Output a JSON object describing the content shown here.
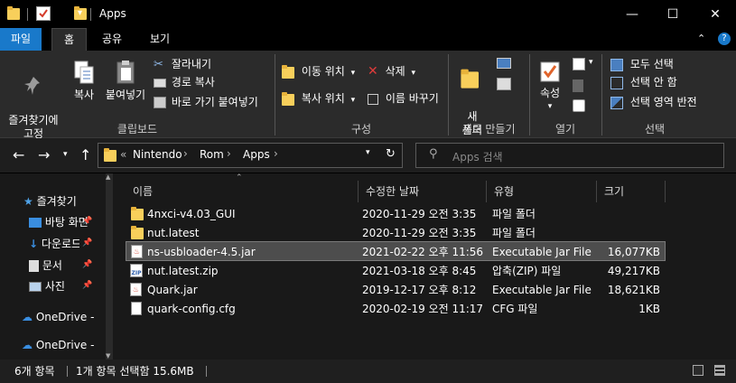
{
  "window": {
    "title": "Apps",
    "minimize": "—",
    "maximize": "☐",
    "close": "✕"
  },
  "tabs": [
    {
      "label": "파일"
    },
    {
      "label": "홈"
    },
    {
      "label": "공유"
    },
    {
      "label": "보기"
    }
  ],
  "ribbon": {
    "clipboard": {
      "pin": "즐겨찾기에\n고정",
      "copy": "복사",
      "paste": "붙여넣기",
      "cut": "잘라내기",
      "copy_path": "경로 복사",
      "paste_shortcut": "바로 가기 붙여넣기",
      "label": "클립보드"
    },
    "organize": {
      "move_to": "이동 위치",
      "copy_to": "복사 위치",
      "delete": "삭제",
      "rename": "이름 바꾸기",
      "label": "구성"
    },
    "new": {
      "new_folder": "새\n폴더",
      "label": "새로 만들기"
    },
    "open": {
      "properties": "속성",
      "label": "열기"
    },
    "select": {
      "select_all": "모두 선택",
      "select_none": "선택 안 함",
      "invert": "선택 영역 반전",
      "label": "선택"
    }
  },
  "address": {
    "prefix": "«",
    "crumbs": [
      "Nintendo",
      "Rom",
      "Apps"
    ],
    "search_placeholder": "Apps 검색"
  },
  "nav": {
    "items": [
      {
        "label": "즐겨찾기"
      },
      {
        "label": "바탕 화면"
      },
      {
        "label": "다운로드"
      },
      {
        "label": "문서"
      },
      {
        "label": "사진"
      },
      {
        "label": "OneDrive -"
      },
      {
        "label": "OneDrive -"
      }
    ]
  },
  "columns": {
    "name": "이름",
    "modified": "수정한 날짜",
    "type": "유형",
    "size": "크기"
  },
  "files": [
    {
      "name": "4nxci-v4.03_GUI",
      "date": "2020-11-29 오전 3:35",
      "type": "파일 폴더",
      "size": "",
      "icon": "folder-icon"
    },
    {
      "name": "nut.latest",
      "date": "2020-11-29 오전 3:35",
      "type": "파일 폴더",
      "size": "",
      "icon": "folder-icon"
    },
    {
      "name": "ns-usbloader-4.5.jar",
      "date": "2021-02-22 오후 11:56",
      "type": "Executable Jar File",
      "size": "16,077KB",
      "icon": "jar-icon"
    },
    {
      "name": "nut.latest.zip",
      "date": "2021-03-18 오후 8:45",
      "type": "압축(ZIP) 파일",
      "size": "49,217KB",
      "icon": "zip-icon"
    },
    {
      "name": "Quark.jar",
      "date": "2019-12-17 오후 8:12",
      "type": "Executable Jar File",
      "size": "18,621KB",
      "icon": "jar-icon"
    },
    {
      "name": "quark-config.cfg",
      "date": "2020-02-19 오전 11:17",
      "type": "CFG 파일",
      "size": "1KB",
      "icon": "file-icon"
    }
  ],
  "status": {
    "count": "6개 항목",
    "selection": "1개 항목 선택함 15.6MB"
  },
  "colors": {
    "accent": "#1979ca",
    "folder": "#f8cf5b",
    "selected_row": "#4d4d4d"
  }
}
